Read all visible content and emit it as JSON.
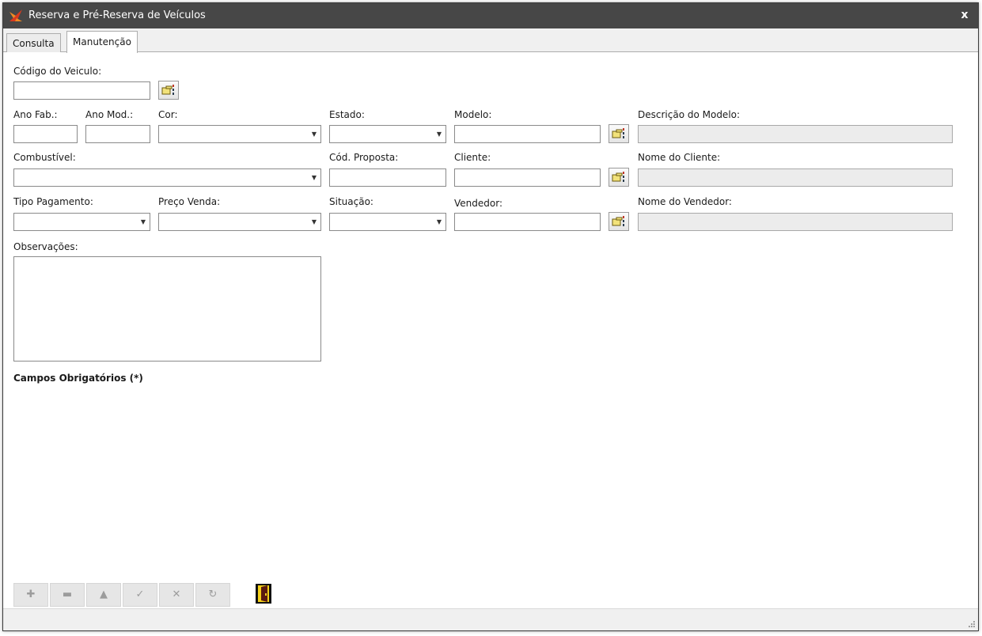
{
  "window": {
    "title": "Reserva e Pré-Reserva de Veículos",
    "close_glyph": "x"
  },
  "tabs": [
    {
      "label": "Consulta",
      "active": false
    },
    {
      "label": "Manutenção",
      "active": true
    }
  ],
  "form": {
    "codigo_veiculo": {
      "label": "Código do Veiculo:",
      "value": ""
    },
    "ano_fab": {
      "label": "Ano Fab.:",
      "value": ""
    },
    "ano_mod": {
      "label": "Ano Mod.:",
      "value": ""
    },
    "cor": {
      "label": "Cor:",
      "value": ""
    },
    "estado": {
      "label": "Estado:",
      "value": ""
    },
    "modelo": {
      "label": "Modelo:",
      "value": ""
    },
    "descricao_modelo": {
      "label": "Descrição do Modelo:",
      "value": ""
    },
    "combustivel": {
      "label": "Combustível:",
      "value": ""
    },
    "cod_proposta": {
      "label": "Cód. Proposta:",
      "value": ""
    },
    "cliente": {
      "label": "Cliente:",
      "value": ""
    },
    "nome_cliente": {
      "label": "Nome do Cliente:",
      "value": ""
    },
    "tipo_pagamento": {
      "label": "Tipo Pagamento:",
      "value": ""
    },
    "preco_venda": {
      "label": "Preço Venda:",
      "value": ""
    },
    "situacao": {
      "label": "Situação:",
      "value": ""
    },
    "vendedor": {
      "label": "Vendedor:",
      "value": ""
    },
    "nome_vendedor": {
      "label": "Nome do Vendedor:",
      "value": ""
    },
    "observacoes": {
      "label": "Observações:",
      "value": ""
    },
    "required_note": "Campos Obrigatórios (*)"
  },
  "toolbar": {
    "buttons": [
      {
        "name": "add",
        "glyph": "✚",
        "icon": "plus-icon",
        "enabled": false
      },
      {
        "name": "remove",
        "glyph": "▬",
        "icon": "minus-icon",
        "enabled": false
      },
      {
        "name": "edit",
        "glyph": "▲",
        "icon": "triangle-up-icon",
        "enabled": false
      },
      {
        "name": "confirm",
        "glyph": "✓",
        "icon": "check-icon",
        "enabled": false
      },
      {
        "name": "cancel",
        "glyph": "✕",
        "icon": "x-icon",
        "enabled": false
      },
      {
        "name": "refresh",
        "glyph": "↻",
        "icon": "refresh-icon",
        "enabled": false
      }
    ],
    "exit_icon": "exit-door-icon"
  },
  "colors": {
    "titlebar": "#474747",
    "logo_red": "#d83a1f",
    "logo_orange": "#f08a24",
    "exit_yellow": "#f6d21a",
    "exit_dark": "#5a1a10",
    "readonly_field": "#ececec"
  }
}
